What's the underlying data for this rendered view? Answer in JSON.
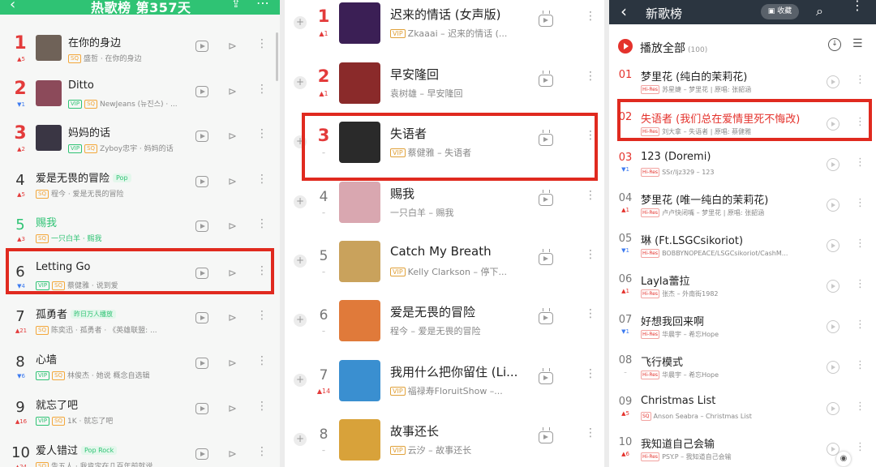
{
  "colors": {
    "qq_green": "#2fc374",
    "rank_red": "#e33b3b",
    "highlight": "#e02a1f",
    "kuwo_header": "#2b3540"
  },
  "panel1": {
    "header": {
      "back_icon": "‹",
      "title": "热歌榜 第357天",
      "share_icon": "share-icon",
      "more_icon": "⋯"
    },
    "rows": [
      {
        "rank": "1",
        "trend_dir": "up",
        "trend": "▲5",
        "title": "在你的身边",
        "tag": "",
        "vip": false,
        "sq": true,
        "sub": "盛哲 · 在你的身边",
        "cover": "#6f6258",
        "style": "top"
      },
      {
        "rank": "2",
        "trend_dir": "down",
        "trend": "▼1",
        "title": "Ditto",
        "tag": "",
        "vip": true,
        "sq": true,
        "sub": "NewJeans (뉴진스) · ...",
        "cover": "#8c4a5a",
        "style": "top"
      },
      {
        "rank": "3",
        "trend_dir": "up",
        "trend": "▲2",
        "title": "妈妈的话",
        "tag": "",
        "vip": true,
        "sq": true,
        "sub": "Zyboy忠宇 · 妈妈的话",
        "cover": "#3a3644",
        "style": "top"
      },
      {
        "rank": "4",
        "trend_dir": "up",
        "trend": "▲5",
        "title": "爱是无畏的冒险",
        "tag": "Pop",
        "vip": false,
        "sq": true,
        "sub": "程今 · 爱是无畏的冒险",
        "cover": "",
        "style": ""
      },
      {
        "rank": "5",
        "trend_dir": "up",
        "trend": "▲3",
        "title": "赐我",
        "tag": "",
        "vip": false,
        "sq": true,
        "sub": "一只白羊 · 赐我",
        "cover": "",
        "style": "green"
      },
      {
        "rank": "6",
        "trend_dir": "down",
        "trend": "▼4",
        "title": "Letting Go",
        "tag": "",
        "vip": true,
        "sq": true,
        "sub": "蔡健雅 · 说到爱",
        "cover": "",
        "style": ""
      },
      {
        "rank": "7",
        "trend_dir": "up",
        "trend": "▲21",
        "title": "孤勇者",
        "tag": "昨日万人播放",
        "vip": false,
        "sq": true,
        "sub": "陈奕迅 · 孤勇者 · 《英雄联盟: ...",
        "cover": "",
        "style": ""
      },
      {
        "rank": "8",
        "trend_dir": "down",
        "trend": "▼6",
        "title": "心墙",
        "tag": "",
        "vip": true,
        "sq": true,
        "sub": "林俊杰 · 她说 概念自选辑",
        "cover": "",
        "style": ""
      },
      {
        "rank": "9",
        "trend_dir": "up",
        "trend": "▲16",
        "title": "就忘了吧",
        "tag": "",
        "vip": true,
        "sq": true,
        "sub": "1K · 就忘了吧",
        "cover": "",
        "style": ""
      },
      {
        "rank": "10",
        "trend_dir": "up",
        "trend": "▲24",
        "title": "爱人错过",
        "tag": "Pop Rock",
        "vip": false,
        "sq": true,
        "sub": "告五人 · 我肯定在几百年前就说...",
        "cover": "",
        "style": ""
      }
    ]
  },
  "panel2": {
    "rows": [
      {
        "rank": "1",
        "trend": "▲1",
        "title": "迟来的情话 (女声版)",
        "vip": true,
        "sub": "Zkaaai – 迟来的情话 (...",
        "cover": "#3b1f55",
        "top": true
      },
      {
        "rank": "2",
        "trend": "▲1",
        "title": "早安隆回",
        "vip": false,
        "sub": "袁树雄 – 早安隆回",
        "cover": "#8a2a2a",
        "top": true
      },
      {
        "rank": "3",
        "trend": "–",
        "title": "失语者",
        "vip": true,
        "sub": "蔡健雅 – 失语者",
        "cover": "#2a2a2a",
        "top": true
      },
      {
        "rank": "4",
        "trend": "–",
        "title": "赐我",
        "vip": false,
        "sub": "一只白羊 – 赐我",
        "cover": "#d9a7b0",
        "top": false
      },
      {
        "rank": "5",
        "trend": "–",
        "title": "Catch My Breath",
        "vip": true,
        "sub": "Kelly Clarkson – 停下...",
        "cover": "#c9a25c",
        "top": false
      },
      {
        "rank": "6",
        "trend": "–",
        "title": "爱是无畏的冒险",
        "vip": false,
        "sub": "程今 – 爱是无畏的冒险",
        "cover": "#e07a3a",
        "top": false
      },
      {
        "rank": "7",
        "trend": "▲14",
        "title": "我用什么把你留住 (Li...",
        "vip": true,
        "sub": "福禄寿FloruitShow –...",
        "cover": "#3a8fd0",
        "top": false
      },
      {
        "rank": "8",
        "trend": "–",
        "title": "故事还长",
        "vip": true,
        "sub": "云汐 – 故事还长",
        "cover": "#d8a23a",
        "top": false
      }
    ]
  },
  "panel3": {
    "header": {
      "back_icon": "‹",
      "title": "新歌榜",
      "fav_label": "收藏",
      "search_icon": "search-icon",
      "menu_icon": "⋮"
    },
    "play_all": {
      "label": "播放全部",
      "count": "(100)"
    },
    "rows": [
      {
        "rank": "01",
        "trend_dir": "none",
        "trend": "",
        "title": "梦里花 (纯白的茉莉花)",
        "sub": "苏星婕 – 梦里花 | 原唱: 张韶涵",
        "badge": "Hi-Res",
        "red_title": false
      },
      {
        "rank": "02",
        "trend_dir": "none",
        "trend": "",
        "title": "失语者 (我们总在爱情里死不悔改)",
        "sub": "刘大拿 – 失语者 | 原唱: 蔡健雅",
        "badge": "Hi-Res",
        "red_title": true
      },
      {
        "rank": "03",
        "trend_dir": "down",
        "trend": "▼1",
        "title": "123 (Doremi)",
        "sub": "SSr/ljz329 – 123",
        "badge": "Hi-Res",
        "red_title": false
      },
      {
        "rank": "04",
        "trend_dir": "up",
        "trend": "▲1",
        "title": "梦里花 (唯一纯白的茉莉花)",
        "sub": "卢卢快闭嘴 – 梦里花 | 原唱: 张韶涵",
        "badge": "Hi-Res",
        "red_title": false
      },
      {
        "rank": "05",
        "trend_dir": "down",
        "trend": "▼1",
        "title": "琳 (Ft.LSGCsikoriot)",
        "sub": "BOBBYNOPEACE/LSGCsikoriot/CashM...",
        "badge": "Hi-Res",
        "red_title": false
      },
      {
        "rank": "06",
        "trend_dir": "up",
        "trend": "▲1",
        "title": "Layla蕾拉",
        "sub": "张杰 – 外南街1982",
        "badge": "Hi-Res",
        "red_title": false
      },
      {
        "rank": "07",
        "trend_dir": "down",
        "trend": "▼1",
        "title": "好想我回来啊",
        "sub": "华晨宇 – 希忘Hope",
        "badge": "Hi-Res",
        "red_title": false
      },
      {
        "rank": "08",
        "trend_dir": "none",
        "trend": "–",
        "title": "飞行模式",
        "sub": "华晨宇 – 希忘Hope",
        "badge": "Hi-Res",
        "red_title": false
      },
      {
        "rank": "09",
        "trend_dir": "up",
        "trend": "▲5",
        "title": "Christmas List",
        "sub": "Anson Seabra – Christmas List",
        "badge": "SQ",
        "red_title": false
      },
      {
        "rank": "10",
        "trend_dir": "up",
        "trend": "▲6",
        "title": "我知道自己会输",
        "sub": "PSY.P – 我知道自己会输",
        "badge": "Hi-Res",
        "red_title": false
      }
    ]
  }
}
